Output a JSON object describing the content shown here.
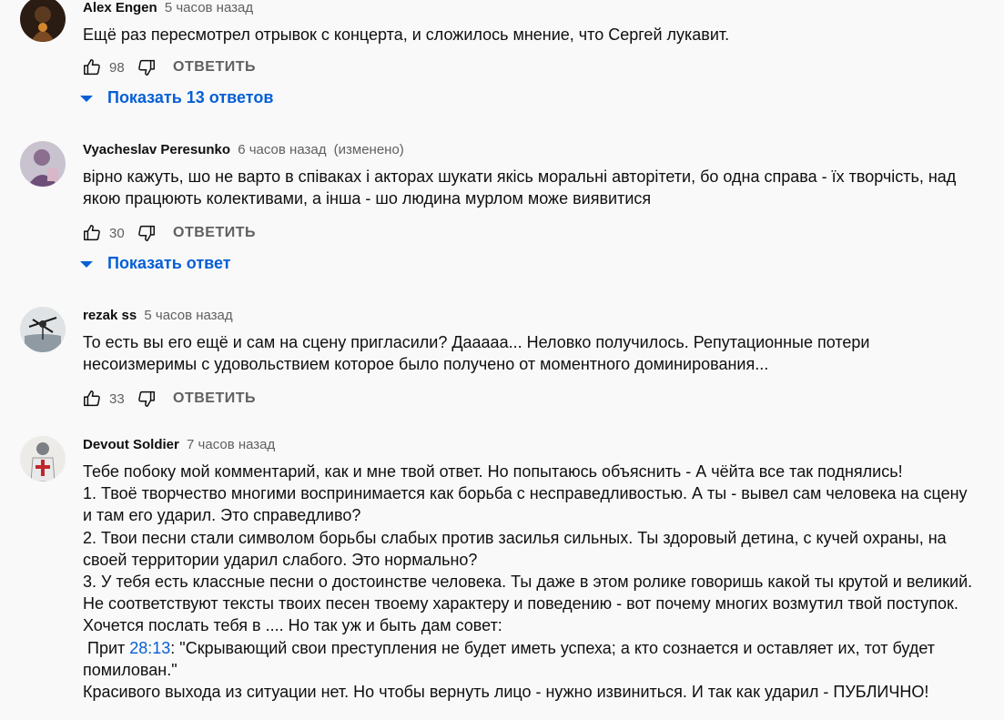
{
  "comments": [
    {
      "author": "Alex Engen",
      "time": "5 часов назад",
      "edited": "",
      "lines": [
        "Ещё раз пересмотрел отрывок с концерта, и сложилось мнение, что Сергей лукавит."
      ],
      "likes": "98",
      "reply_label": "ОТВЕТИТЬ",
      "replies_label": "Показать 13 ответов"
    },
    {
      "author": "Vyacheslav Peresunko",
      "time": "6 часов назад",
      "edited": "(изменено)",
      "lines": [
        "вірно кажуть, шо не варто в співаках і акторах шукати якісь моральні авторітети, бо одна справа - їх творчість, над",
        "якою працюють колективами, а інша - шо людина мурлом може виявитися"
      ],
      "likes": "30",
      "reply_label": "ОТВЕТИТЬ",
      "replies_label": "Показать ответ"
    },
    {
      "author": "rezak ss",
      "time": "5 часов назад",
      "edited": "",
      "lines": [
        "То есть вы его ещё и сам на сцену пригласили? Дааааа... Неловко получилось. Репутационные потери",
        "несоизмеримы с удовольствием которое было получено от моментного доминирования..."
      ],
      "likes": "33",
      "reply_label": "ОТВЕТИТЬ",
      "replies_label": ""
    },
    {
      "author": "Devout Soldier",
      "time": "7 часов назад",
      "edited": "",
      "lines": [
        "Тебе побоку мой комментарий, как и мне твой ответ. Но попытаюсь объяснить - А чёйта все так поднялись!",
        "1. Твоё творчество многими воспринимается как борьба с несправедливостью. А ты - вывел сам человека на сцену",
        "и там его ударил. Это справедливо?",
        "2. Твои песни стали символом борьбы слабых против засилья сильных. Ты здоровый детина, с кучей охраны, на",
        "своей территории ударил слабого. Это нормально?",
        "3. У тебя есть классные песни о достоинстве человека. Ты даже в этом ролике говоришь какой ты крутой и великий.",
        "Не соответствуют тексты твоих песен твоему характеру и поведению - вот почему многих возмутил твой поступок.",
        "Хочется послать тебя в .... Но так уж и быть дам совет:"
      ],
      "quote_prefix": " Прит ",
      "quote_link": "28:13",
      "quote_rest": ": \"Скрывающий свои преступления не будет иметь успеха; а кто сознается и оставляет их, тот будет",
      "quote_line2": "помилован.\"",
      "last_line": "Красивого выхода из ситуации нет. Но чтобы вернуть лицо - нужно извиниться. И так как ударил - ПУБЛИЧНО!"
    }
  ],
  "icons": {
    "like": "thumb-up-icon",
    "dislike": "thumb-down-icon",
    "expand": "triangle-down-icon"
  },
  "colors": {
    "link": "#065fd4",
    "secondary_text": "#606060",
    "background": "#f9f9f9"
  }
}
